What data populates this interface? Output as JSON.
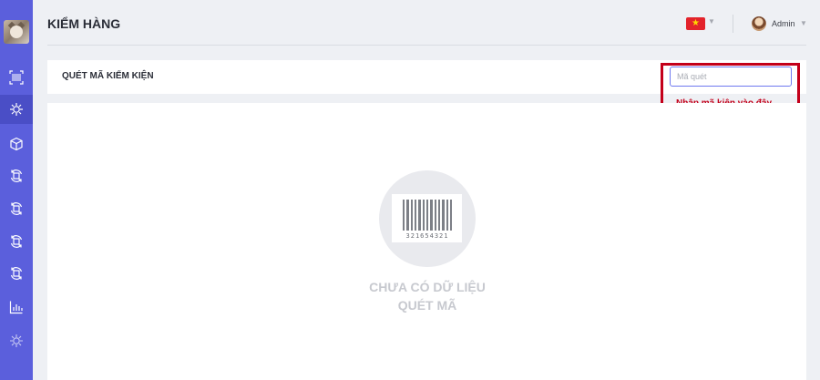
{
  "header": {
    "title": "KIỂM HÀNG",
    "language": {
      "flag": "vietnam-flag",
      "flag_color": "#e3232b"
    },
    "user": {
      "name": "Admin"
    }
  },
  "sidebar": {
    "bg_color": "#5b5fdc",
    "active_index": 1,
    "items": [
      {
        "icon": "barcode-scan-icon"
      },
      {
        "icon": "virus-icon"
      },
      {
        "icon": "box-icon"
      },
      {
        "icon": "refresh-box-icon"
      },
      {
        "icon": "refresh-box-icon"
      },
      {
        "icon": "refresh-box-icon"
      },
      {
        "icon": "refresh-box-icon"
      },
      {
        "icon": "bar-chart-icon"
      },
      {
        "icon": "virus-icon"
      }
    ]
  },
  "scan": {
    "title": "QUÉT MÃ KIỂM KIỆN",
    "input_placeholder": "Mã quét",
    "input_value": "",
    "hint": "Nhập mã kiện vào đây",
    "hint_color": "#c4001a"
  },
  "empty_state": {
    "barcode_number": "321654321",
    "line1": "CHƯA CÓ DỮ LIỆU",
    "line2": "QUÉT MÃ"
  }
}
